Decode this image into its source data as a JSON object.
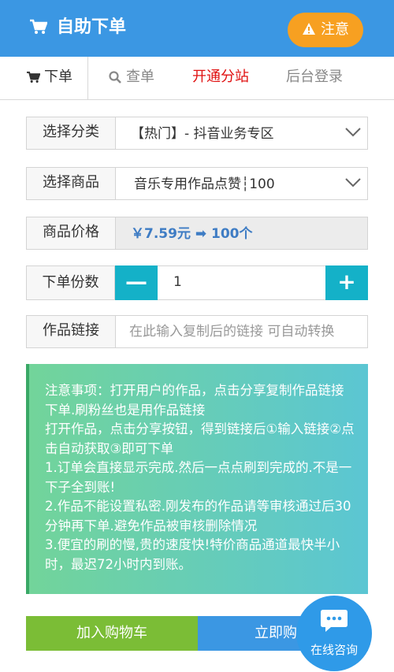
{
  "header": {
    "title": "自助下单",
    "notice_label": "注意"
  },
  "tabs": [
    {
      "label": "下单"
    },
    {
      "label": "查单"
    },
    {
      "label": "开通分站"
    },
    {
      "label": "后台登录"
    }
  ],
  "form": {
    "category": {
      "label": "选择分类",
      "value": "【热门】- 抖音业务专区"
    },
    "product": {
      "label": "选择商品",
      "value": "音乐专用作品点赞┆100"
    },
    "price": {
      "label": "商品价格",
      "value": "￥7.59元 ➡ 100个"
    },
    "quantity": {
      "label": "下单份数",
      "value": "1",
      "minus": "—",
      "plus": "+"
    },
    "link": {
      "label": "作品链接",
      "placeholder": "在此输入复制后的链接 可自动转换"
    }
  },
  "notes": [
    "注意事项：打开用户的作品，点击分享复制作品链接下单.刷粉丝也是用作品链接",
    "打开作品，点击分享按钮，得到链接后①输入链接②点击自动获取③即可下单",
    "1.订单会直接显示完成.然后一点点刷到完成的.不是一下子全到账!",
    "2.作品不能设置私密.刚发布的作品请等审核通过后30分钟再下单.避免作品被审核删除情况",
    "3.便宜的刷的慢,贵的速度快!特价商品通道最快半小时，最迟72小时内到账。"
  ],
  "actions": {
    "add_cart": "加入购物车",
    "buy_now": "立即购"
  },
  "chat": {
    "label": "在线咨询"
  },
  "colors": {
    "primary": "#3b97e3",
    "accent": "#14b1c8",
    "warning": "#f7a021",
    "green": "#7bbd36",
    "red": "#e01010"
  }
}
